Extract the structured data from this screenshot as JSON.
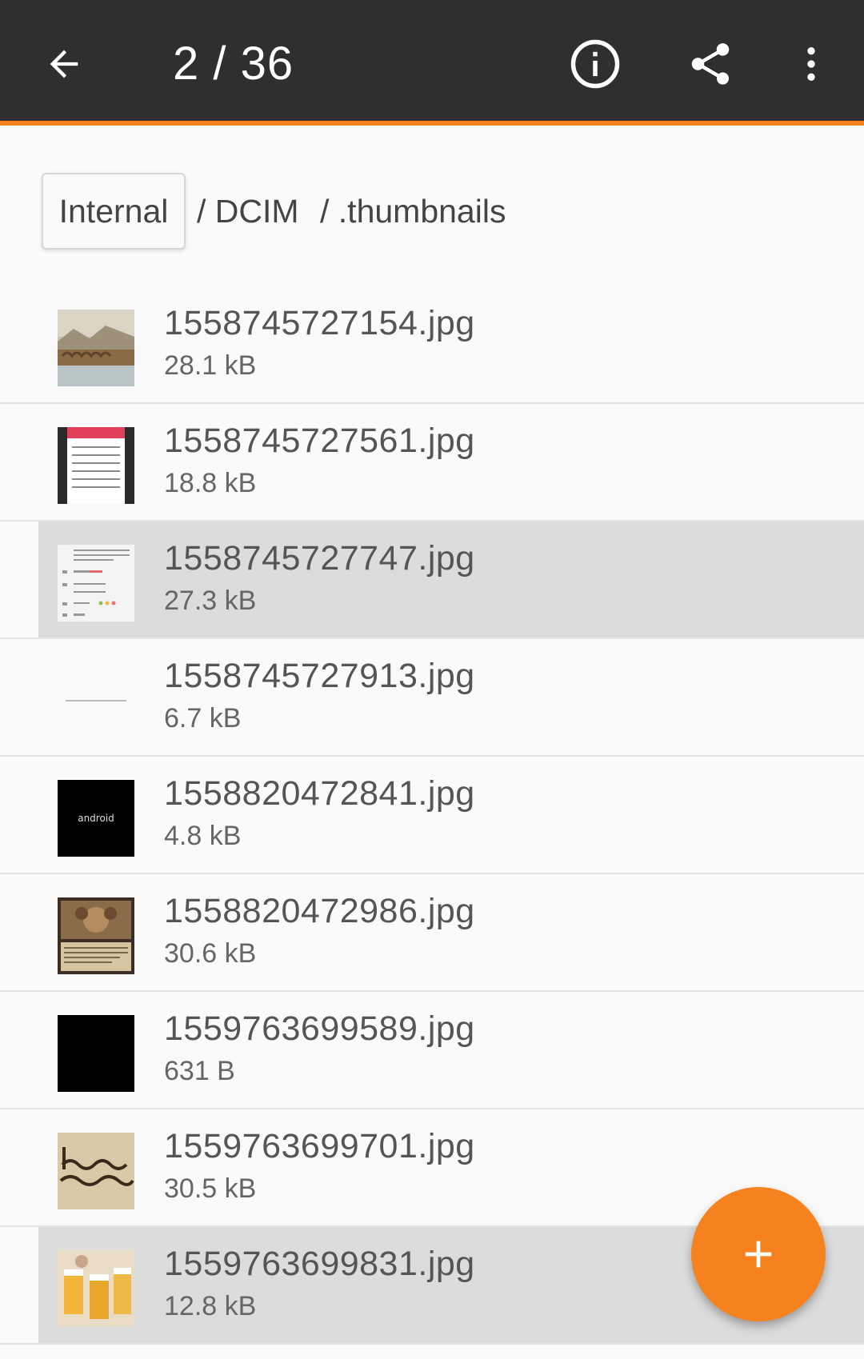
{
  "appbar": {
    "title": "2 / 36",
    "icons": [
      "arrow-back-icon",
      "info-icon",
      "share-icon",
      "more-vert-icon"
    ],
    "accent": "#f5821f",
    "background": "#2f2f2f"
  },
  "breadcrumb": {
    "root": "Internal",
    "parts": [
      "/ DCIM",
      "/ .thumbnails"
    ]
  },
  "files": [
    {
      "name": "1558745727154.jpg",
      "size": "28.1 kB"
    },
    {
      "name": "1558745727561.jpg",
      "size": "18.8 kB"
    },
    {
      "name": "1558745727747.jpg",
      "size": "27.3 kB"
    },
    {
      "name": "1558745727913.jpg",
      "size": "6.7 kB"
    },
    {
      "name": "1558820472841.jpg",
      "size": "4.8 kB",
      "thumb_text": "android"
    },
    {
      "name": "1558820472986.jpg",
      "size": "30.6 kB"
    },
    {
      "name": "1559763699589.jpg",
      "size": "631 B"
    },
    {
      "name": "1559763699701.jpg",
      "size": "30.5 kB"
    },
    {
      "name": "1559763699831.jpg",
      "size": "12.8 kB"
    }
  ],
  "fab": {
    "icon": "plus-icon",
    "color": "#f5821f"
  }
}
